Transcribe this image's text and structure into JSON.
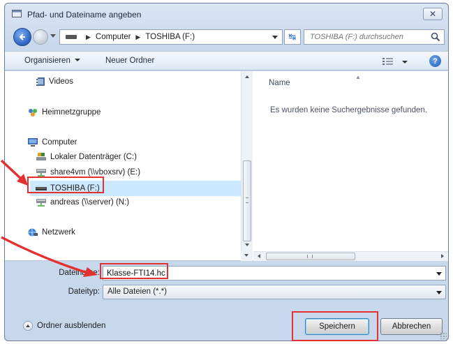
{
  "window": {
    "title": "Pfad- und Dateiname angeben",
    "close_label": "✕"
  },
  "address": {
    "crumbs": [
      "Computer",
      "TOSHIBA (F:)"
    ],
    "search_placeholder": "TOSHIBA (F:) durchsuchen"
  },
  "toolbar": {
    "organize_label": "Organisieren",
    "new_folder_label": "Neuer Ordner",
    "help_label": "?"
  },
  "nav_tree": {
    "items": [
      {
        "label": "Videos",
        "icon": "videos-icon"
      },
      {
        "label": "Heimnetzgruppe",
        "icon": "homegroup-icon"
      },
      {
        "label": "Computer",
        "icon": "computer-icon"
      },
      {
        "label": "Lokaler Datenträger (C:)",
        "icon": "local-disk-icon"
      },
      {
        "label": "share4vm (\\\\vboxsrv) (E:)",
        "icon": "network-drive-icon"
      },
      {
        "label": "TOSHIBA (F:)",
        "icon": "usb-drive-icon",
        "selected": true
      },
      {
        "label": "andreas (\\\\server) (N:)",
        "icon": "network-drive-icon"
      },
      {
        "label": "Netzwerk",
        "icon": "network-icon"
      }
    ]
  },
  "file_list": {
    "column_name": "Name",
    "empty_message": "Es wurden keine Suchergebnisse gefunden."
  },
  "form": {
    "filename_label": "Dateiname:",
    "filename_value": "Klasse-FTI14.hc",
    "filetype_label": "Dateityp:",
    "filetype_value": "Alle Dateien (*.*)"
  },
  "footer": {
    "hide_folders_label": "Ordner ausblenden",
    "save_label": "Speichern",
    "cancel_label": "Abbrechen"
  },
  "colors": {
    "annotation": "#e53030",
    "selection": "#cce8ff",
    "window_frame": "#c8d8ec"
  }
}
